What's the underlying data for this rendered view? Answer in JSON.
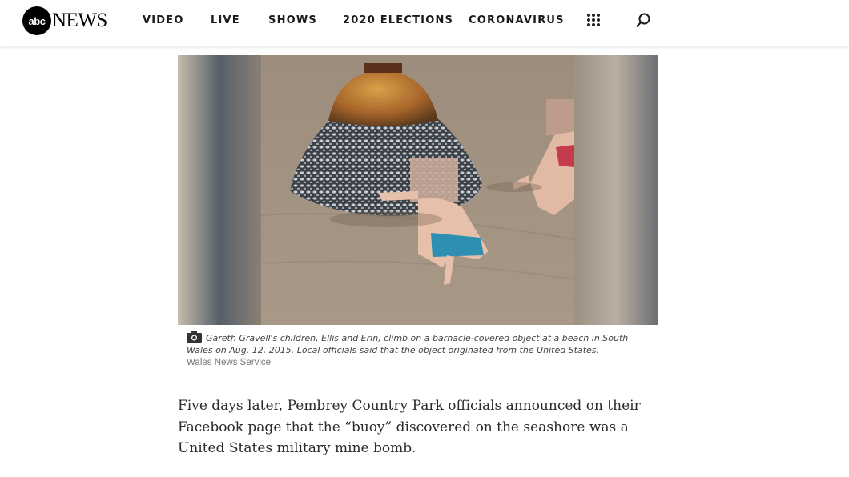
{
  "header": {
    "logo_mark": "abc",
    "logo_word": "NEWS",
    "nav": [
      "VIDEO",
      "LIVE",
      "SHOWS",
      "2020 ELECTIONS",
      "CORONAVIRUS"
    ],
    "menu_icon": "apps-grid-icon",
    "search_icon": "search-icon"
  },
  "photo": {
    "description_icon": "camera-icon",
    "caption": "Gareth Gravell's children, Ellis and Erin, climb on a barnacle-covered object at a beach in South Wales on Aug. 12, 2015. Local officials said that the object originated from the United States.",
    "credit": "Wales News Service"
  },
  "article": {
    "paragraph": "Five days later, Pembrey Country Park officials announced on their Facebook page that the “buoy” discovered on the seashore was a United States military mine bomb."
  },
  "colors": {
    "accent": "#000000",
    "text": "#2a2a2a",
    "caption": "#444444",
    "credit": "#777777"
  }
}
